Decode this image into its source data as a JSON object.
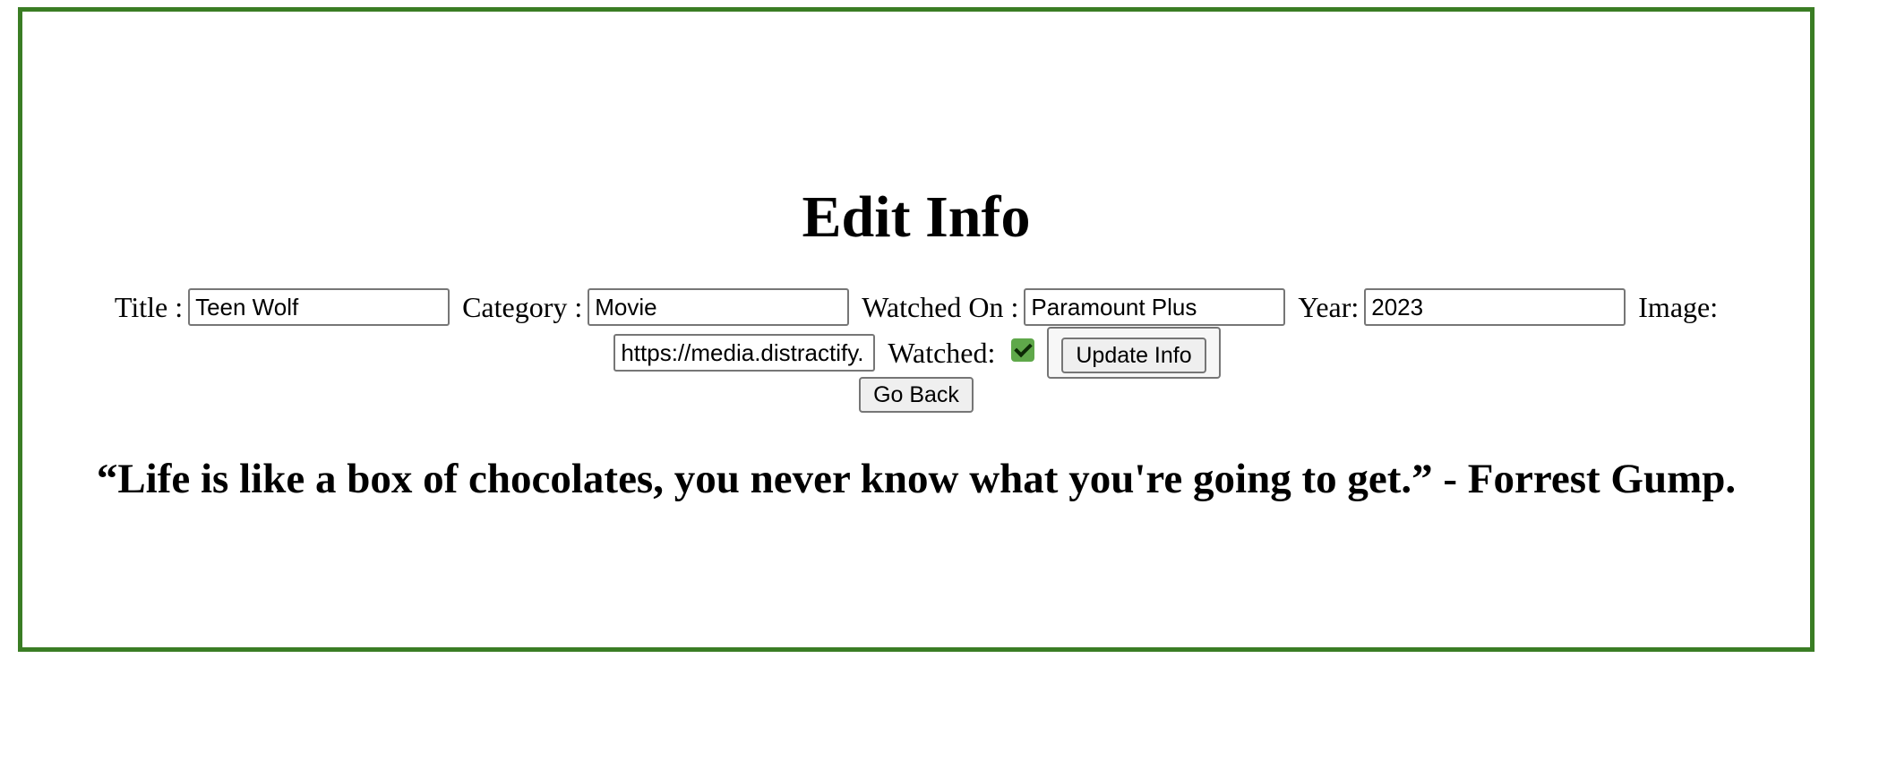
{
  "page": {
    "title": "Edit Info",
    "accent_border_color": "#3a7d24"
  },
  "form": {
    "title_label": "Title :",
    "title_value": "Teen Wolf",
    "category_label": "Category :",
    "category_value": "Movie",
    "watched_on_label": "Watched On :",
    "watched_on_value": "Paramount Plus",
    "year_label": "Year:",
    "year_value": "2023",
    "image_label": "Image:",
    "image_value": "https://media.distractify.",
    "watched_label": "Watched:",
    "watched_checked": true,
    "checkbox_color": "#5fa84a",
    "update_button_label": "Update Info",
    "go_back_button_label": "Go Back"
  },
  "quote": {
    "text": "“Life is like a box of chocolates, you never know what you're going to get.” - Forrest Gump."
  }
}
